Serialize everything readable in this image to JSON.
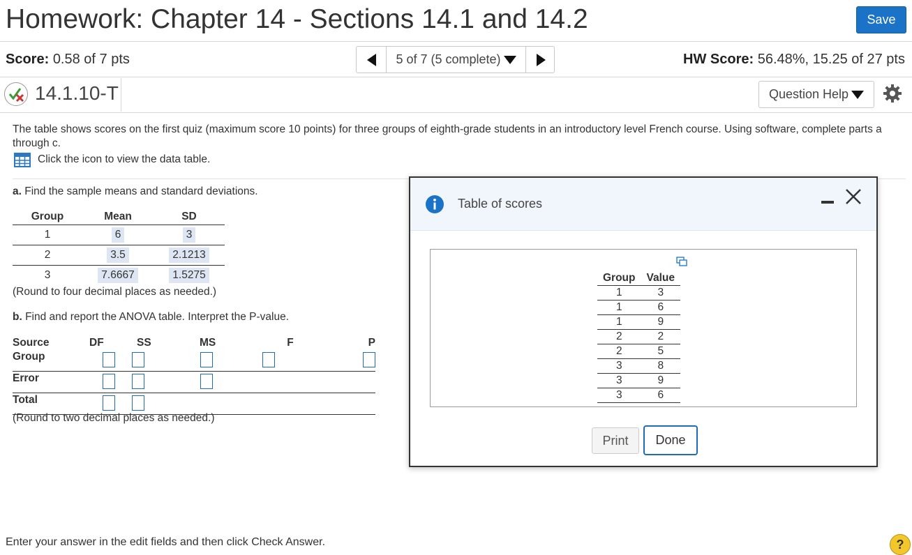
{
  "header": {
    "title": "Homework: Chapter 14 - Sections 14.1 and 14.2",
    "save_label": "Save"
  },
  "score": {
    "label": "Score:",
    "value": "0.58 of 7 pts"
  },
  "nav": {
    "position_label": "5 of 7 (5 complete)"
  },
  "hw_score": {
    "label": "HW Score:",
    "value": "56.48%, 15.25 of 27 pts"
  },
  "question": {
    "id": "14.1.10-T",
    "help_label": "Question Help",
    "prompt": "The table shows scores on the first quiz (maximum score 10 points) for three groups of eighth-grade students in an introductory level French course. Using software, complete parts a through c.",
    "table_link": "Click the icon to view the data table.",
    "part_a_bold": "a.",
    "part_a_text": " Find the sample means and standard deviations.",
    "means_headers": [
      "Group",
      "Mean",
      "SD"
    ],
    "means_rows": [
      {
        "group": "1",
        "mean": "6",
        "sd": "3"
      },
      {
        "group": "2",
        "mean": "3.5",
        "sd": "2.1213"
      },
      {
        "group": "3",
        "mean": "7.6667",
        "sd": "1.5275"
      }
    ],
    "round_a": "(Round to four decimal places as needed.)",
    "part_b_bold": "b.",
    "part_b_text": " Find and report the ANOVA table. Interpret the P-value.",
    "anova_headers": [
      "Source",
      "DF",
      "SS",
      "MS",
      "F",
      "P"
    ],
    "anova_rows": [
      "Group",
      "Error",
      "Total"
    ],
    "round_b": "(Round to two decimal places as needed.)",
    "footer": "Enter your answer in the edit fields and then click Check Answer."
  },
  "modal": {
    "title": "Table of scores",
    "headers": [
      "Group",
      "Value"
    ],
    "rows": [
      [
        "1",
        "3"
      ],
      [
        "1",
        "6"
      ],
      [
        "1",
        "9"
      ],
      [
        "2",
        "2"
      ],
      [
        "2",
        "5"
      ],
      [
        "3",
        "8"
      ],
      [
        "3",
        "9"
      ],
      [
        "3",
        "6"
      ]
    ],
    "print_label": "Print",
    "done_label": "Done"
  },
  "colors": {
    "accent": "#1a73c6",
    "answer_highlight": "#dde6f2",
    "help_bubble": "#f3c72c"
  }
}
